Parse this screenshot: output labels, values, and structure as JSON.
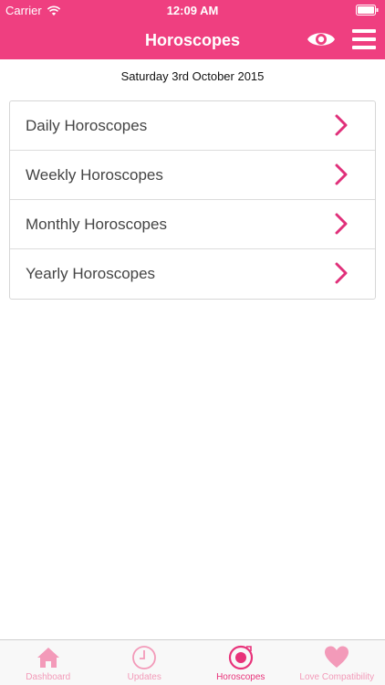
{
  "status_bar": {
    "carrier": "Carrier",
    "time": "12:09 AM"
  },
  "nav": {
    "title": "Horoscopes",
    "eye_icon": "eye-icon",
    "menu_icon": "hamburger-menu-icon"
  },
  "date": "Saturday 3rd October 2015",
  "list": {
    "items": [
      {
        "label": "Daily Horoscopes"
      },
      {
        "label": "Weekly Horoscopes"
      },
      {
        "label": "Monthly Horoscopes"
      },
      {
        "label": "Yearly Horoscopes"
      }
    ]
  },
  "tab_bar": {
    "tabs": [
      {
        "label": "Dashboard",
        "icon": "home-icon"
      },
      {
        "label": "Updates",
        "icon": "clock-icon"
      },
      {
        "label": "Horoscopes",
        "icon": "target-icon",
        "active": true
      },
      {
        "label": "Love Compatibility",
        "icon": "heart-icon"
      }
    ]
  },
  "colors": {
    "brand_pink": "#ef3f80",
    "chevron_pink": "#e0307a",
    "tab_inactive": "#f39ab9",
    "tab_active": "#e8337a"
  }
}
